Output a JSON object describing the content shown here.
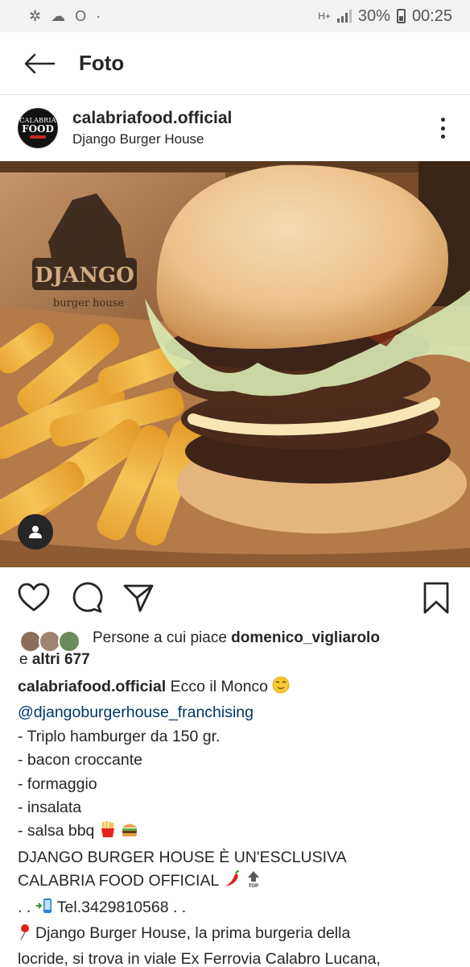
{
  "status_bar": {
    "battery": "30%",
    "time": "00:25",
    "network": "H+"
  },
  "topbar": {
    "title": "Foto"
  },
  "post": {
    "username": "calabriafood.official",
    "location": "Django Burger House",
    "avatar_text": [
      "CALABRIA",
      "FOOD"
    ],
    "photo_sign": [
      "DJANGO",
      "burger house"
    ]
  },
  "likes": {
    "prefix": "Persone a cui piace ",
    "user": "domenico_vigliarolo",
    "connector": "e ",
    "others": "altri 677"
  },
  "caption": {
    "username": "calabriafood.official",
    "first_text": "Ecco il Monco",
    "mention": "@djangoburgerhouse_franchising",
    "lines": [
      "- Triplo hamburger da 150 gr.",
      "- bacon croccante",
      "- formaggio",
      "- insalata",
      "- salsa bbq",
      "DJANGO BURGER HOUSE È UN'ESCLUSIVA",
      "CALABRIA FOOD OFFICIAL",
      ". . ",
      "Tel.3429810568 . .",
      "Django Burger House, la prima burgeria della",
      "locride, si trova in viale Ex Ferrovia Calabro Lucana,"
    ]
  },
  "colors": {
    "text": "#262626",
    "mention": "#003569",
    "divider": "#dbdbdb",
    "status_bg": "#f2f2f2"
  },
  "icons": [
    "back-arrow-icon",
    "more-options-icon",
    "heart-icon",
    "comment-icon",
    "share-icon",
    "bookmark-icon",
    "user-tag-icon"
  ]
}
